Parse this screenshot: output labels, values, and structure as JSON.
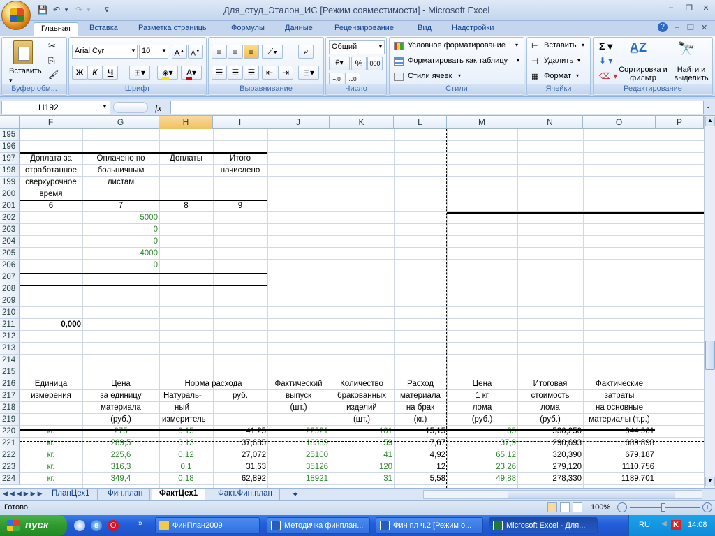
{
  "window": {
    "title": "Для_студ_Эталон_ИС  [Режим совместимости] - Microsoft Excel"
  },
  "ribbon_tabs": [
    "Главная",
    "Вставка",
    "Разметка страницы",
    "Формулы",
    "Данные",
    "Рецензирование",
    "Вид",
    "Надстройки"
  ],
  "ribbon": {
    "clipboard": {
      "paste": "Вставить",
      "label": "Буфер обм..."
    },
    "font": {
      "name": "Arial Cyr",
      "size": "10",
      "bold": "Ж",
      "italic": "К",
      "underline": "Ч",
      "label": "Шрифт"
    },
    "alignment": {
      "label": "Выравнивание"
    },
    "number": {
      "format": "Общий",
      "percent": "%",
      "thousands": "000",
      "label": "Число"
    },
    "styles": {
      "cond": "Условное форматирование",
      "table": "Форматировать как таблицу",
      "cell": "Стили ячеек",
      "label": "Стили"
    },
    "cells": {
      "insert": "Вставить",
      "delete": "Удалить",
      "format": "Формат",
      "label": "Ячейки"
    },
    "editing": {
      "sort": "Сортировка и фильтр",
      "find": "Найти и выделить",
      "label": "Редактирование"
    }
  },
  "formula_bar": {
    "name_box": "H192",
    "fx": "fx",
    "value": ""
  },
  "columns": [
    "F",
    "G",
    "H",
    "I",
    "J",
    "K",
    "L",
    "M",
    "N",
    "O",
    "P"
  ],
  "selected_column": "H",
  "rows": [
    "195",
    "196",
    "197",
    "198",
    "199",
    "200",
    "201",
    "202",
    "203",
    "204",
    "205",
    "206",
    "207",
    "208",
    "209",
    "210",
    "211",
    "212",
    "213",
    "214",
    "215",
    "216",
    "217",
    "218",
    "219",
    "220",
    "221",
    "222",
    "223",
    "224"
  ],
  "upper_header": {
    "f": [
      "Доплата за",
      "отработанное",
      "сверхурочное",
      "время"
    ],
    "g": [
      "Оплачено по",
      "больничным",
      "листам"
    ],
    "h": [
      "Доплаты"
    ],
    "i": [
      "Итого",
      "начислено"
    ],
    "nums": [
      "6",
      "7",
      "8",
      "9"
    ]
  },
  "g_values": [
    "5000",
    "0",
    "0",
    "4000",
    "0"
  ],
  "f211": "0,000",
  "lower_header": {
    "f": [
      "Единица",
      "измерения"
    ],
    "g": [
      "Цена",
      "за единицу",
      "материала",
      "(руб.)"
    ],
    "hi_top": "Норма расхода",
    "h": [
      "Натураль-",
      "ный",
      "измеритель"
    ],
    "i": [
      "руб."
    ],
    "j": [
      "Фактический",
      "выпуск",
      "(шт.)"
    ],
    "k": [
      "Количество",
      "бракованных",
      "изделий",
      "(шт.)"
    ],
    "l": [
      "Расход",
      "материала",
      "на брак",
      "(кг.)"
    ],
    "m": [
      "Цена",
      "1 кг",
      "лома",
      "(руб.)"
    ],
    "n": [
      "Итоговая",
      "стоимость",
      "лома",
      "(руб.)"
    ],
    "o": [
      "Фактические",
      "затраты",
      "на основные",
      "материалы (т.р.)"
    ]
  },
  "data_rows": [
    [
      "кг.",
      "275",
      "0,15",
      "41,25",
      "22921",
      "101",
      "15,15",
      "35",
      "530,250",
      "944,961"
    ],
    [
      "кг.",
      "289,5",
      "0,13",
      "37,635",
      "18339",
      "59",
      "7,67",
      "37,9",
      "290,693",
      "689,898"
    ],
    [
      "кг.",
      "225,6",
      "0,12",
      "27,072",
      "25100",
      "41",
      "4,92",
      "65,12",
      "320,390",
      "679,187"
    ],
    [
      "кг.",
      "316,3",
      "0,1",
      "31,63",
      "35126",
      "120",
      "12",
      "23,26",
      "279,120",
      "1110,756"
    ],
    [
      "кг.",
      "349,4",
      "0,18",
      "62,892",
      "18921",
      "31",
      "5,58",
      "49,88",
      "278,330",
      "1189,701"
    ]
  ],
  "sheet_tabs": [
    "ПланЦех1",
    "Фин.план",
    "ФактЦех1",
    "Факт.Фин.план"
  ],
  "active_sheet": "ФактЦех1",
  "status": {
    "ready": "Готово",
    "zoom": "100%"
  },
  "taskbar": {
    "start": "пуск",
    "items": [
      "ФинПлан2009",
      "Методичка финплан...",
      "Фин пл ч.2 [Режим о...",
      "Microsoft Excel - Для..."
    ],
    "lang": "RU",
    "clock": "14:08"
  }
}
